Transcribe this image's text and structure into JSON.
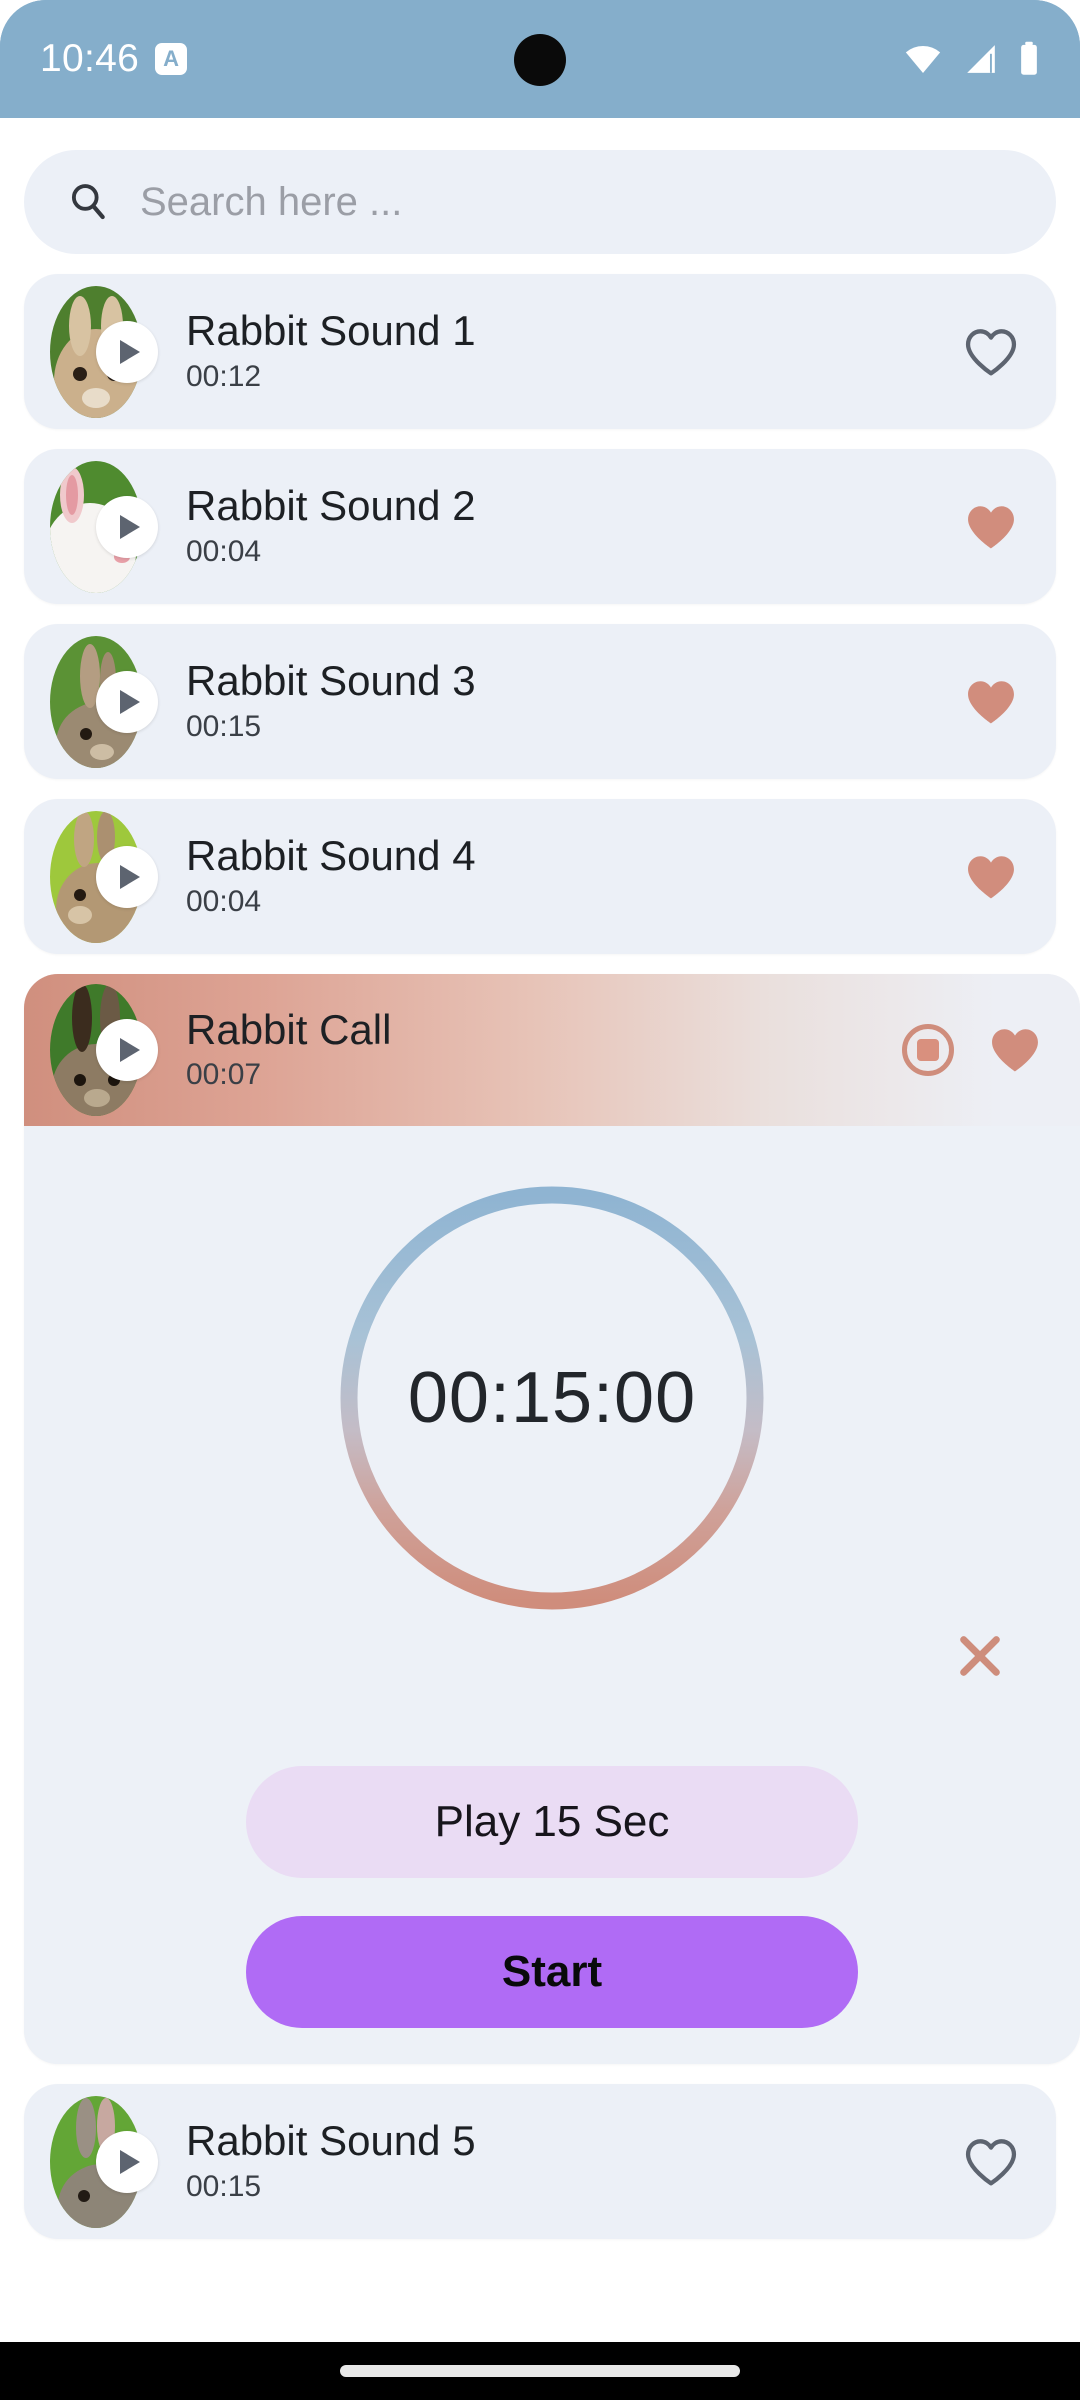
{
  "status_bar": {
    "time": "10:46",
    "app_badge_letter": "A",
    "icons": [
      "wifi-icon",
      "cellular-signal-icon",
      "battery-icon"
    ]
  },
  "search": {
    "placeholder": "Search here ...",
    "value": "",
    "icon": "search-icon"
  },
  "colors": {
    "status_bar_bg": "#85aecb",
    "card_bg": "#ecf0f7",
    "page_bg": "#ffffff",
    "heart_filled": "#d18d7d",
    "heart_outline": "#5d6470",
    "accent_salmon": "#d08f7e",
    "start_button": "#b06bf5",
    "play_button": "#eadcf4",
    "ring_top": "#8fb4d2",
    "ring_bottom": "#cf8d7c"
  },
  "sounds": [
    {
      "title": "Rabbit Sound 1",
      "duration": "00:12",
      "favorite": false,
      "play_icon": "play-icon",
      "heart_icon": "heart-outline-icon"
    },
    {
      "title": "Rabbit Sound 2",
      "duration": "00:04",
      "favorite": true,
      "play_icon": "play-icon",
      "heart_icon": "heart-filled-icon"
    },
    {
      "title": "Rabbit Sound 3",
      "duration": "00:15",
      "favorite": true,
      "play_icon": "play-icon",
      "heart_icon": "heart-filled-icon"
    },
    {
      "title": "Rabbit Sound 4",
      "duration": "00:04",
      "favorite": true,
      "play_icon": "play-icon",
      "heart_icon": "heart-filled-icon"
    }
  ],
  "expanded_item": {
    "title": "Rabbit Call",
    "duration": "00:07",
    "favorite": true,
    "play_icon": "play-icon",
    "stop_icon": "stop-icon",
    "heart_icon": "heart-filled-icon",
    "timer_value": "00:15:00",
    "close_icon": "close-x-icon",
    "play_button_label": "Play 15 Sec",
    "start_button_label": "Start"
  },
  "next_item": {
    "title": "Rabbit Sound 5",
    "duration": "00:15",
    "favorite": false,
    "play_icon": "play-icon",
    "heart_icon": "heart-outline-icon"
  },
  "nav": {
    "handle": "home-gesture-bar"
  }
}
